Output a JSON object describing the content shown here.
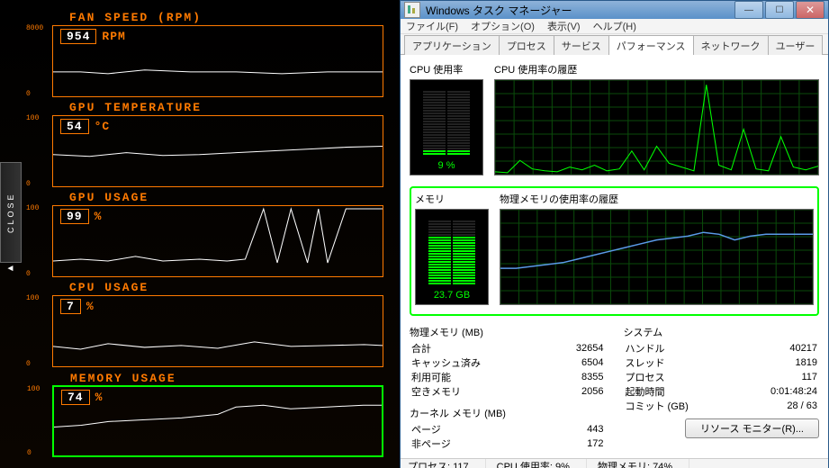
{
  "hud": {
    "close_label": "CLOSE",
    "panels": [
      {
        "title": "FAN SPEED (RPM)",
        "value": "954",
        "unit": "RPM",
        "scale_top": "8000",
        "scale_bot": "0",
        "highlight": false,
        "spark": "0,50 30,50 60,52 100,48 150,50 200,50 250,52 300,50 360,50"
      },
      {
        "title": "GPU TEMPERATURE",
        "value": "54",
        "unit": "°C",
        "scale_top": "100",
        "scale_bot": "0",
        "highlight": false,
        "spark": "0,42 40,44 80,40 120,43 160,42 200,40 240,38 280,36 320,34 360,33"
      },
      {
        "title": "GPU USAGE",
        "value": "99",
        "unit": "%",
        "scale_top": "100",
        "scale_bot": "0",
        "highlight": false,
        "spark": "0,60 30,58 60,60 90,55 120,60 160,58 190,60 210,58 230,3 245,62 260,3 278,62 290,3 300,62 320,3 335,3 350,3 360,3"
      },
      {
        "title": "CPU USAGE",
        "value": "7",
        "unit": "%",
        "scale_top": "100",
        "scale_bot": "0",
        "highlight": false,
        "spark": "0,55 30,58 60,52 100,56 140,54 180,57 220,50 260,55 300,54 340,53 360,54"
      },
      {
        "title": "MEMORY USAGE",
        "value": "74",
        "unit": "%",
        "scale_top": "100",
        "scale_bot": "0",
        "highlight": true,
        "spark": "0,44 30,42 60,38 100,36 140,34 180,30 200,22 230,20 260,24 300,22 340,20 360,20"
      }
    ]
  },
  "tm": {
    "title": "Windows タスク マネージャー",
    "menu": [
      "ファイル(F)",
      "オプション(O)",
      "表示(V)",
      "ヘルプ(H)"
    ],
    "tabs": [
      "アプリケーション",
      "プロセス",
      "サービス",
      "パフォーマンス",
      "ネットワーク",
      "ユーザー"
    ],
    "active_tab": 3,
    "cpu": {
      "label": "CPU 使用率",
      "hist_label": "CPU 使用率の履歴",
      "value": "9 %",
      "fill_pct": 9
    },
    "mem": {
      "label": "メモリ",
      "hist_label": "物理メモリの使用率の履歴",
      "value": "23.7 GB",
      "fill_pct": 74
    },
    "phys_mem": {
      "header": "物理メモリ (MB)",
      "rows": [
        [
          "合計",
          "32654"
        ],
        [
          "キャッシュ済み",
          "6504"
        ],
        [
          "利用可能",
          "8355"
        ],
        [
          "空きメモリ",
          "2056"
        ]
      ]
    },
    "kernel_mem": {
      "header": "カーネル メモリ (MB)",
      "rows": [
        [
          "ページ",
          "443"
        ],
        [
          "非ページ",
          "172"
        ]
      ]
    },
    "system": {
      "header": "システム",
      "rows": [
        [
          "ハンドル",
          "40217"
        ],
        [
          "スレッド",
          "1819"
        ],
        [
          "プロセス",
          "117"
        ],
        [
          "起動時間",
          "0:01:48:24"
        ],
        [
          "コミット (GB)",
          "28 / 63"
        ]
      ]
    },
    "res_btn": "リソース モニター(R)...",
    "status": [
      "プロセス: 117",
      "CPU 使用率: 9%",
      "物理メモリ: 74%"
    ]
  },
  "chart_data": [
    {
      "type": "line",
      "title": "FAN SPEED (RPM)",
      "ylabel": "RPM",
      "ylim": [
        0,
        8000
      ],
      "current": 954,
      "values": [
        950,
        950,
        960,
        940,
        950,
        950,
        960,
        950,
        954
      ]
    },
    {
      "type": "line",
      "title": "GPU TEMPERATURE",
      "ylabel": "°C",
      "ylim": [
        0,
        100
      ],
      "current": 54,
      "values": [
        48,
        47,
        50,
        48,
        49,
        50,
        52,
        54,
        55,
        54
      ]
    },
    {
      "type": "line",
      "title": "GPU USAGE",
      "ylabel": "%",
      "ylim": [
        0,
        100
      ],
      "current": 99,
      "values": [
        10,
        12,
        10,
        14,
        10,
        12,
        10,
        12,
        99,
        5,
        99,
        5,
        99,
        5,
        99,
        99,
        99,
        99
      ]
    },
    {
      "type": "line",
      "title": "CPU USAGE",
      "ylabel": "%",
      "ylim": [
        0,
        100
      ],
      "current": 7,
      "values": [
        14,
        10,
        18,
        12,
        14,
        11,
        20,
        13,
        15,
        14,
        16,
        7
      ]
    },
    {
      "type": "line",
      "title": "MEMORY USAGE",
      "ylabel": "%",
      "ylim": [
        0,
        100
      ],
      "current": 74,
      "values": [
        40,
        42,
        46,
        48,
        50,
        54,
        66,
        70,
        64,
        68,
        72,
        74
      ]
    },
    {
      "type": "line",
      "title": "CPU 使用率の履歴",
      "ylabel": "%",
      "ylim": [
        0,
        100
      ],
      "current": 9,
      "values": [
        3,
        2,
        15,
        6,
        4,
        3,
        8,
        5,
        10,
        4,
        6,
        25,
        5,
        30,
        12,
        8,
        4,
        95,
        10,
        5,
        48,
        6,
        4,
        40,
        8,
        5,
        9
      ]
    },
    {
      "type": "line",
      "title": "物理メモリの使用率の履歴",
      "ylabel": "%",
      "ylim": [
        0,
        100
      ],
      "current": 74,
      "values": [
        38,
        38,
        40,
        42,
        44,
        48,
        52,
        56,
        60,
        64,
        68,
        70,
        72,
        76,
        74,
        68,
        72,
        74,
        74,
        74,
        74
      ]
    }
  ]
}
